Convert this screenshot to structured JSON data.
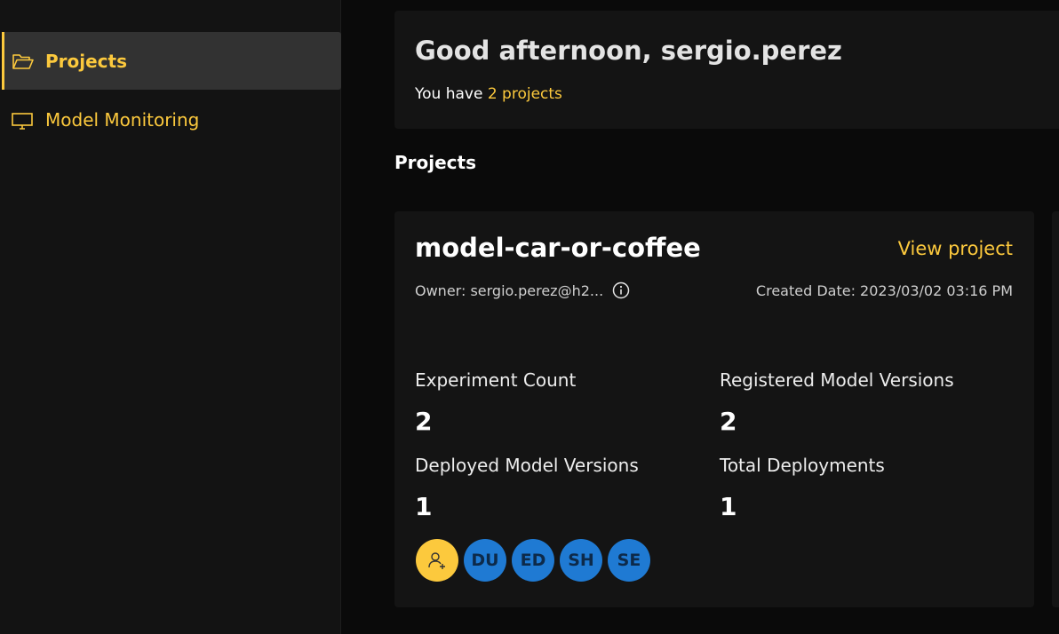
{
  "sidebar": {
    "items": [
      {
        "label": "Projects",
        "icon": "folder-open-icon",
        "active": true
      },
      {
        "label": "Model Monitoring",
        "icon": "monitor-icon",
        "active": false
      }
    ]
  },
  "greeting": {
    "title": "Good afternoon, sergio.perez",
    "prefix": "You have ",
    "link": "2 projects"
  },
  "section_title": "Projects",
  "project": {
    "name": "model-car-or-coffee",
    "view_link": "View project",
    "owner": "Owner: sergio.perez@h2...",
    "created": "Created Date: 2023/03/02 03:16 PM",
    "stats": {
      "experiment_count_label": "Experiment Count",
      "experiment_count": "2",
      "registered_label": "Registered Model Versions",
      "registered": "2",
      "deployed_label": "Deployed Model Versions",
      "deployed": "1",
      "total_deployments_label": "Total Deployments",
      "total_deployments": "1"
    },
    "collaborators": [
      "DU",
      "ED",
      "SH",
      "SE"
    ]
  },
  "colors": {
    "accent": "#fcc93d",
    "avatar": "#1f7ad3",
    "card": "#141414",
    "background": "#0a0a0a"
  }
}
